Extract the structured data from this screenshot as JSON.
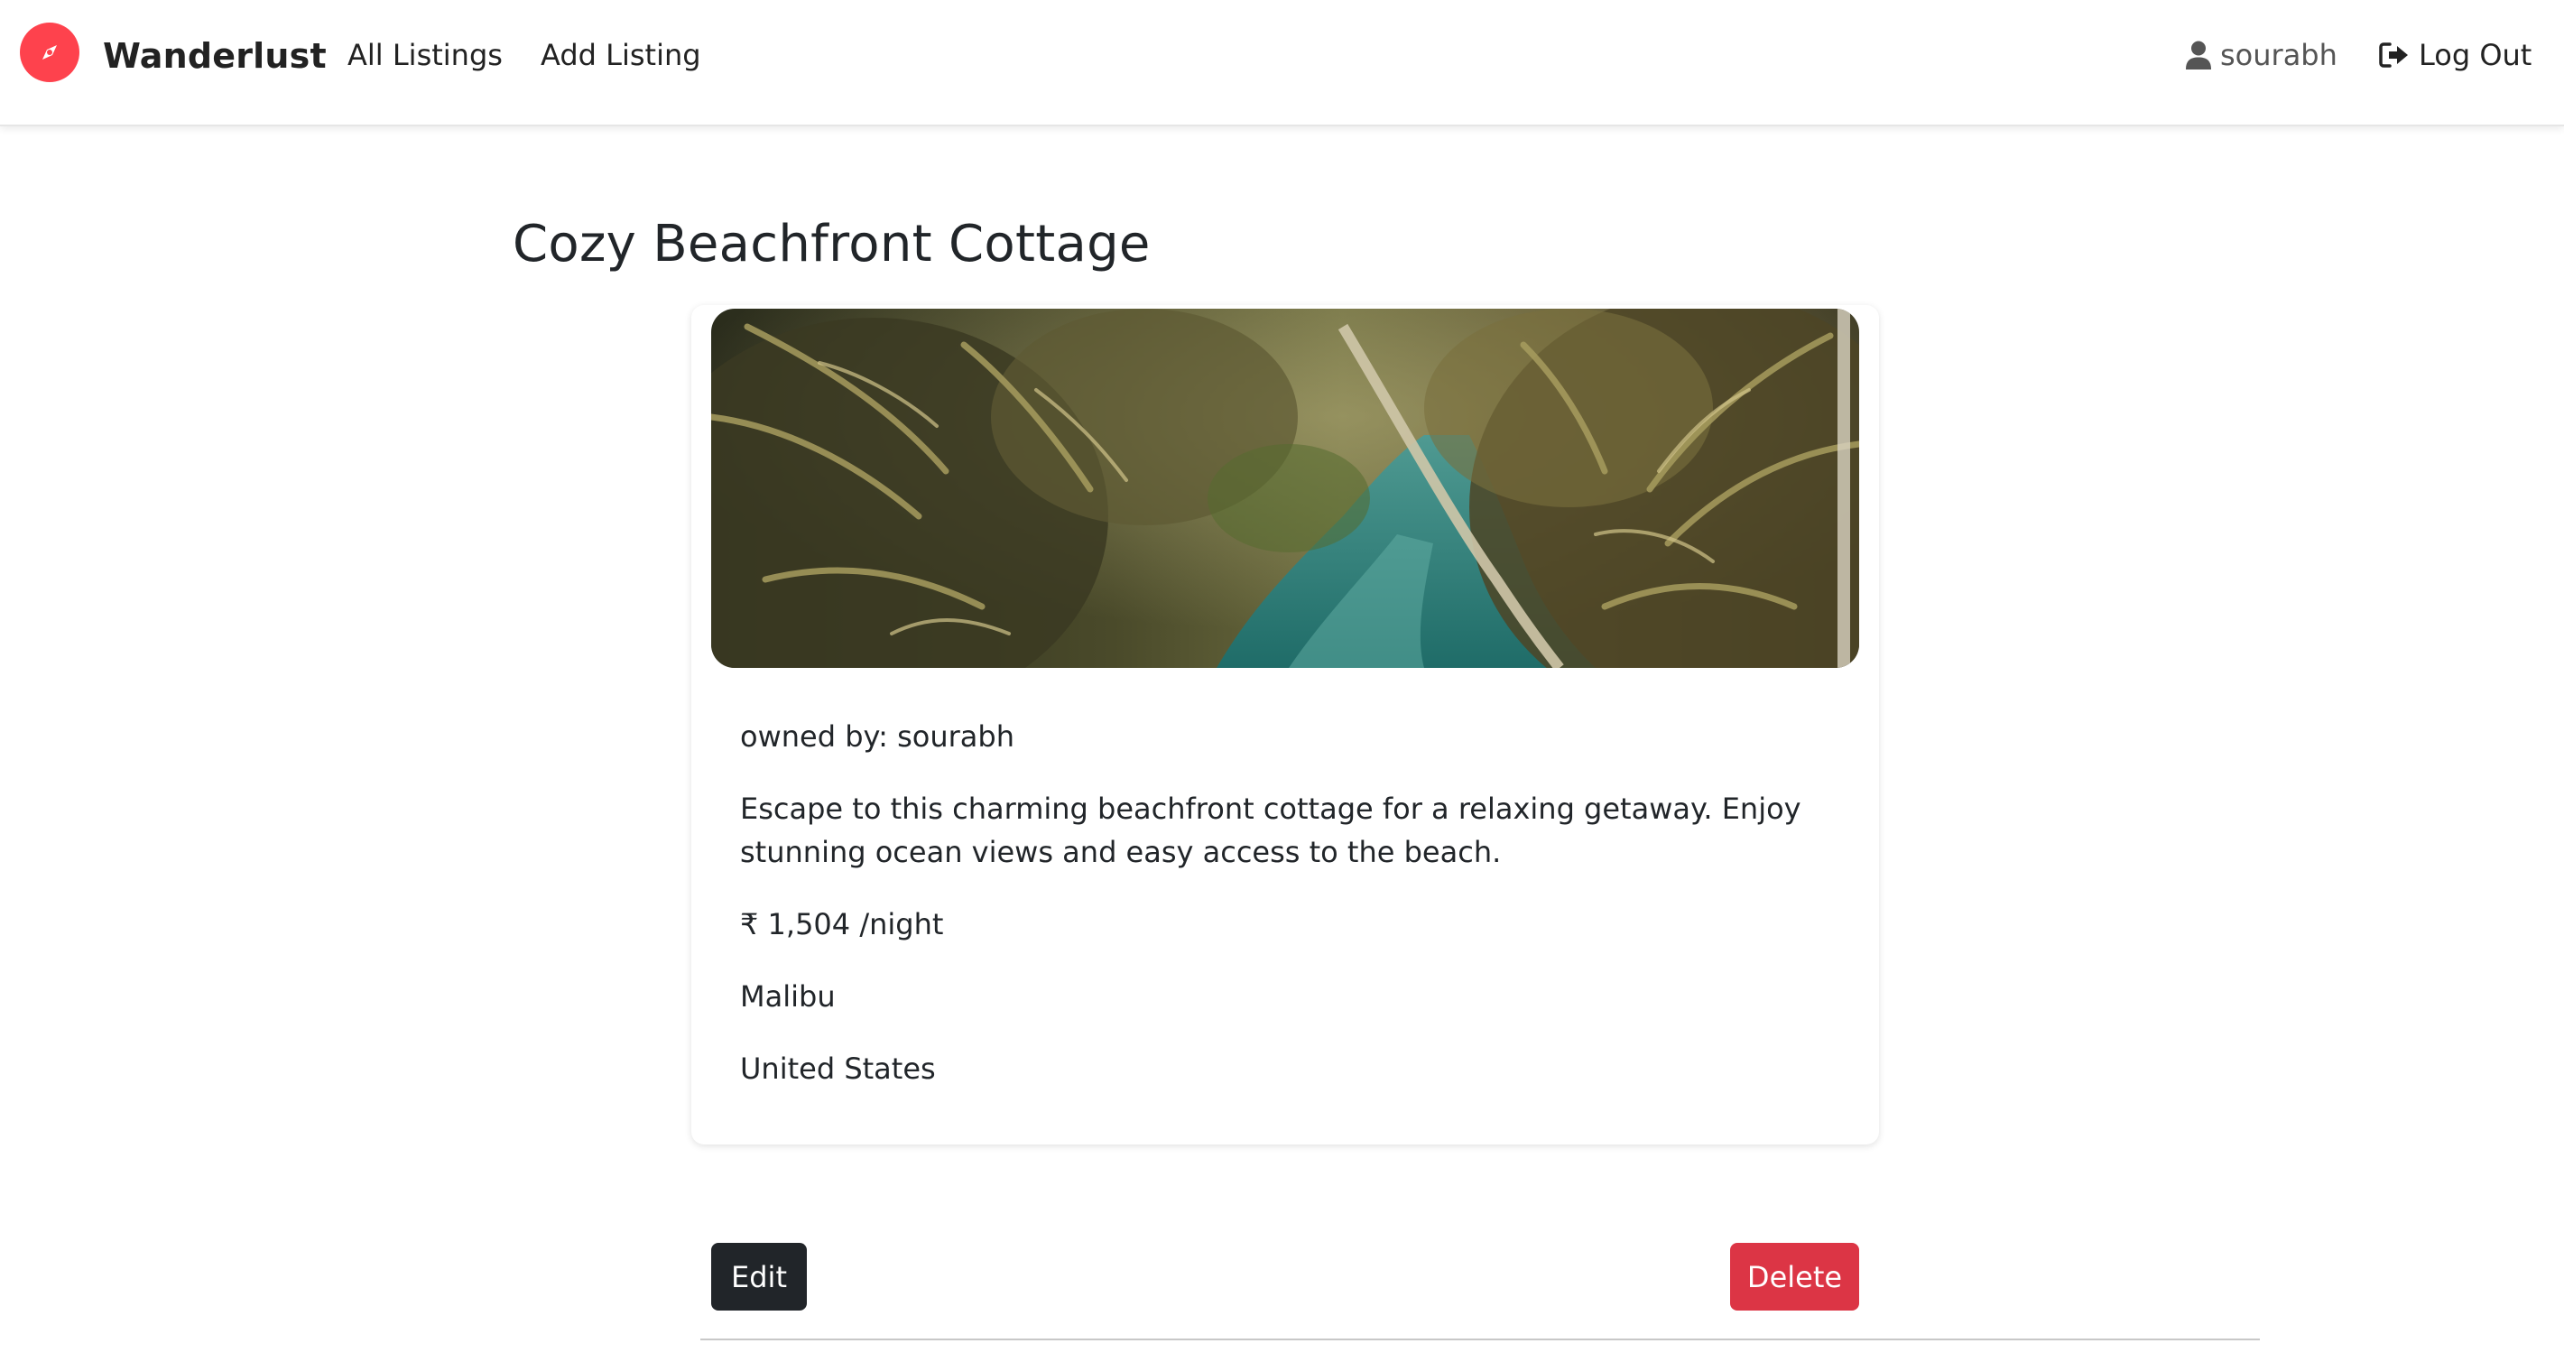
{
  "nav": {
    "brand": "Wanderlust",
    "brand_icon": "compass-icon",
    "brand_color": "#fe424d",
    "all_listings": "All Listings",
    "add_listing": "Add Listing",
    "user": "sourabh",
    "logout": "Log Out"
  },
  "listing": {
    "title": "Cozy Beachfront Cottage",
    "image_alt_icon": "tropical-river-photo",
    "owner": "owned by: sourabh",
    "description": "Escape to this charming beachfront cottage for a relaxing getaway. Enjoy stunning ocean views and easy access to the beach.",
    "price": "₹ 1,504 /night",
    "location": "Malibu",
    "country": "United States"
  },
  "actions": {
    "edit": "Edit",
    "delete": "Delete",
    "edit_color": "#212529",
    "delete_color": "#dc3545"
  }
}
